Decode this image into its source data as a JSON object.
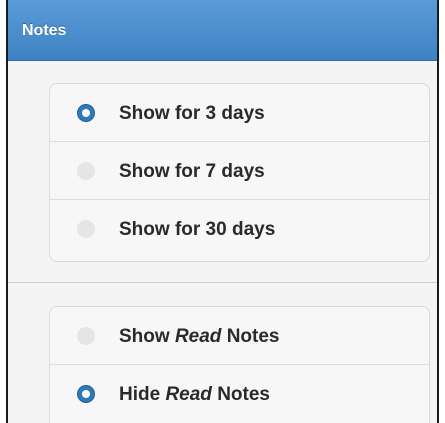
{
  "header": {
    "title": "Notes"
  },
  "duration_group": {
    "options": [
      {
        "label": "Show for 3 days",
        "selected": true
      },
      {
        "label": "Show for 7 days",
        "selected": false
      },
      {
        "label": "Show for 30 days",
        "selected": false
      }
    ]
  },
  "read_group": {
    "options": [
      {
        "prefix": "Show ",
        "emphasis": "Read",
        "suffix": " Notes",
        "selected": false
      },
      {
        "prefix": "Hide ",
        "emphasis": "Read",
        "suffix": " Notes",
        "selected": true
      }
    ]
  },
  "colors": {
    "header": "#4a8fcf",
    "radio_selected": "#2f79b9",
    "radio_unselected": "#e5e5e5",
    "text": "#2a2a2a"
  }
}
